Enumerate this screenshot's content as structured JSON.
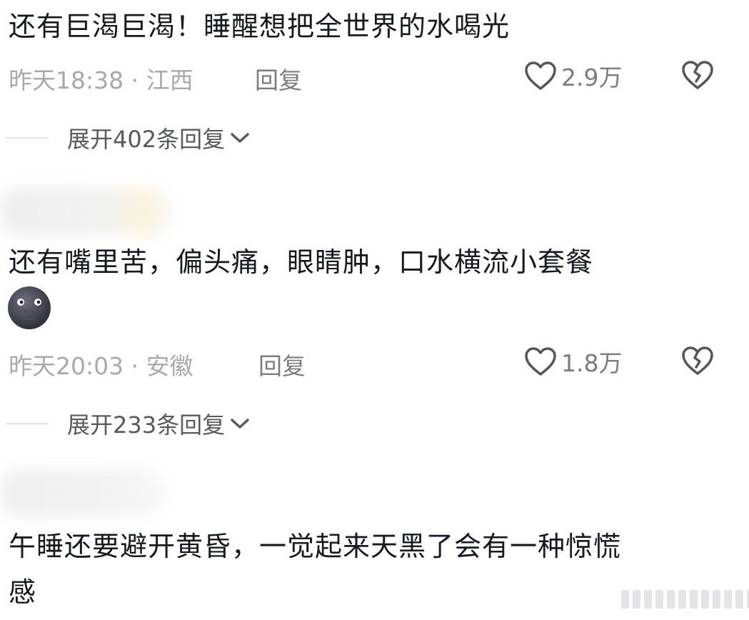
{
  "comments": [
    {
      "text": "还有巨渴巨渴！睡醒想把全世界的水喝光",
      "time": "昨天18:38 · 江西",
      "reply_label": "回复",
      "likes": "2.9万",
      "expand_label": "展开402条回复"
    },
    {
      "text": "还有嘴里苦，偏头痛，眼睛肿，口水横流小套餐",
      "emoji": "new-moon-face-emoji",
      "time": "昨天20:03 · 安徽",
      "reply_label": "回复",
      "likes": "1.8万",
      "expand_label": "展开233条回复"
    },
    {
      "text_line1": "午睡还要避开黄昏，一觉起来天黑了会有一种惊慌",
      "text_line2": "感"
    }
  ],
  "icons": {
    "like": "heart-outline-icon",
    "dislike": "broken-heart-icon",
    "expand": "chevron-down-icon"
  },
  "colors": {
    "text": "#161823",
    "meta": "#a8a9ae",
    "secondary": "#7b7c82"
  }
}
